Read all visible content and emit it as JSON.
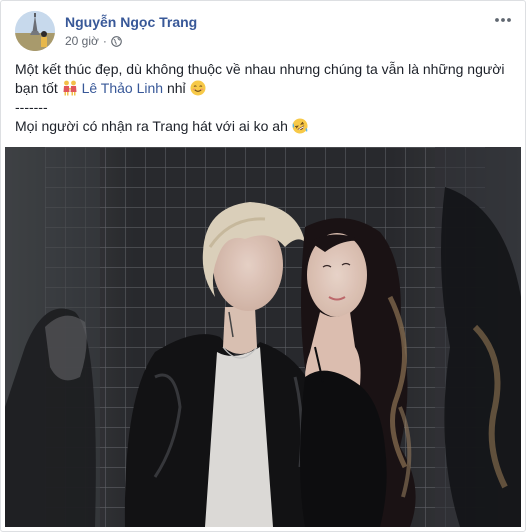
{
  "post": {
    "author": "Nguyễn Ngọc Trang",
    "timestamp": "20 giờ",
    "privacy_icon": "globe-icon",
    "more_icon": "more-options-icon",
    "text_line1": "Một kết thúc đẹp, dù không thuộc về nhau nhưng chúng ta vẫn là những người",
    "text_line2_prefix": "bạn tốt ",
    "mention": "Lê Thảo Linh",
    "text_line2_suffix": " nhỉ ",
    "separator": "-------",
    "text_line4": "Mọi người có nhận ra Trang hát với ai ko ah ",
    "emojis": [
      "two-women-holding-hands-icon",
      "smiling-face-icon",
      "rolling-laughing-face-icon"
    ]
  },
  "colors": {
    "name_link": "#385898",
    "body_text": "#1d2129",
    "meta_text": "#616770",
    "border": "#dddfe2"
  }
}
